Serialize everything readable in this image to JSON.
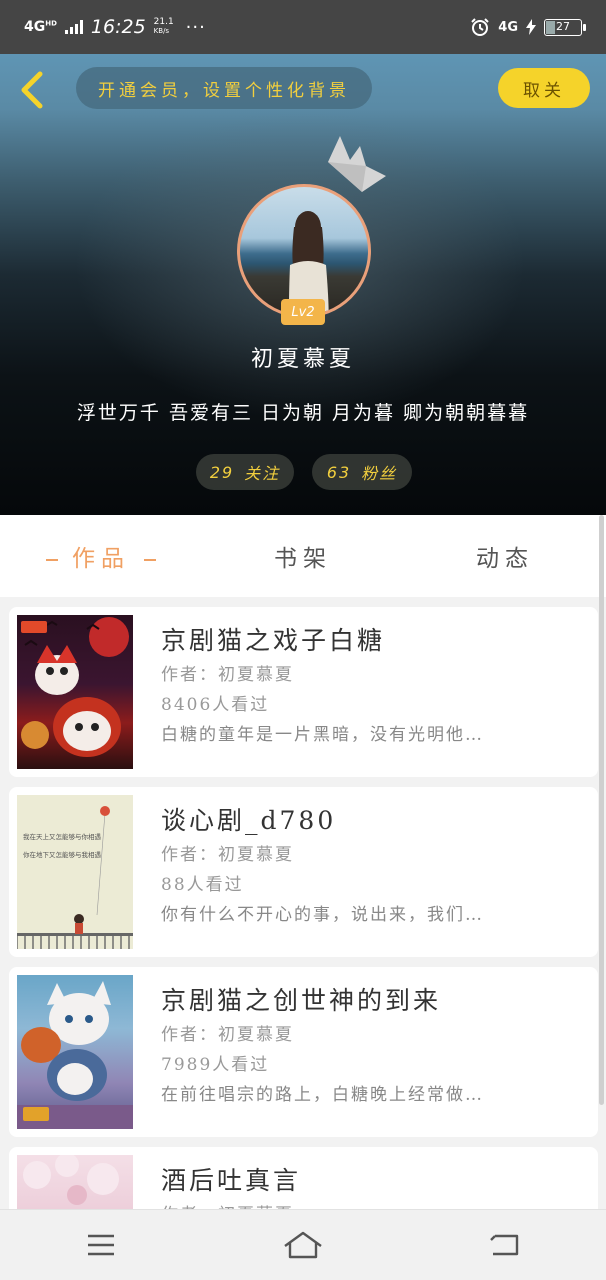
{
  "status_bar": {
    "network": "4G",
    "network_sup": "HD",
    "time": "16:25",
    "speed_value": "21.1",
    "speed_unit": "KB/s",
    "more": "···",
    "net_right": "4G",
    "battery": "27"
  },
  "header": {
    "vip_banner": "开通会员，设置个性化背景",
    "cancel_label": "取关"
  },
  "profile": {
    "level": "Lv2",
    "username": "初夏慕夏",
    "signature": "浮世万千  吾爱有三  日为朝  月为暮  卿为朝朝暮暮",
    "follow_count": "29",
    "follow_label": "关注",
    "fans_count": "63",
    "fans_label": "粉丝"
  },
  "tabs": [
    {
      "label": "作品",
      "active": true
    },
    {
      "label": "书架",
      "active": false
    },
    {
      "label": "动态",
      "active": false
    }
  ],
  "works": [
    {
      "title": "京剧猫之戏子白糖",
      "author": "作者：初夏慕夏",
      "views": "8406人看过",
      "desc": "白糖的童年是一片黑暗，没有光明他…"
    },
    {
      "title": "谈心剧_d780",
      "author": "作者：初夏慕夏",
      "views": "88人看过",
      "desc": "你有什么不开心的事，说出来，我们…"
    },
    {
      "title": "京剧猫之创世神的到来",
      "author": "作者：初夏慕夏",
      "views": "7989人看过",
      "desc": "在前往唱宗的路上，白糖晚上经常做…"
    },
    {
      "title": "酒后吐真言",
      "author": "作者：初夏慕夏",
      "views": "",
      "desc": ""
    }
  ],
  "cover_texts": {
    "cover2_line1": "我在天上又怎能够与你相遇",
    "cover2_line2": "你在地下又怎能够与我相遇"
  },
  "colors": {
    "accent": "#f0a063",
    "yellow": "#f5d32a",
    "vip_text": "#f2cf3e"
  }
}
